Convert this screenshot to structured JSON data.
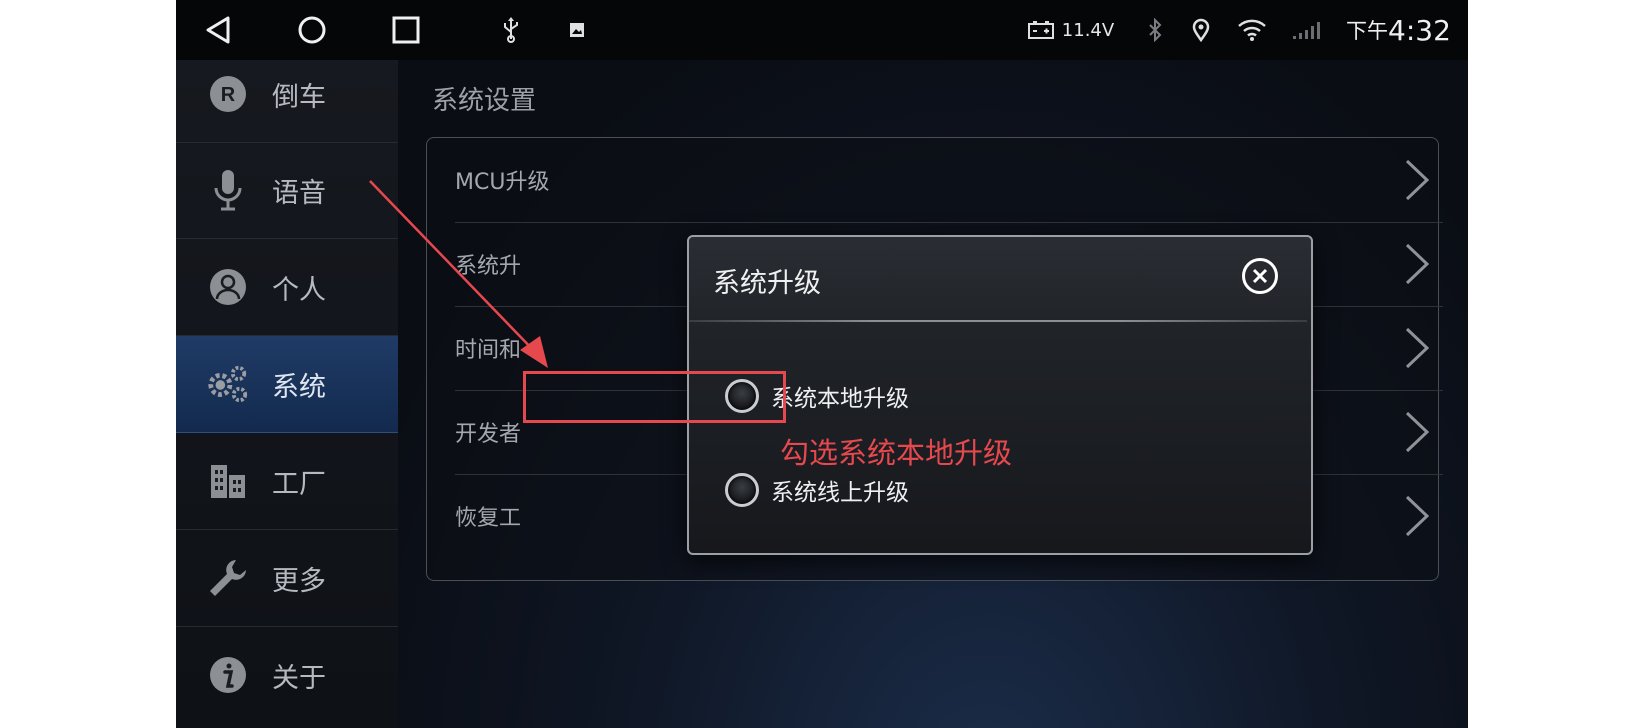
{
  "statusbar": {
    "voltage": "11.4V",
    "time_prefix": "下午",
    "time": "4:32",
    "nav_icons": [
      "back-icon",
      "home-icon",
      "recents-icon"
    ],
    "status_icons": [
      "usb-icon",
      "image-icon",
      "battery-icon",
      "bluetooth-icon",
      "location-icon",
      "wifi-icon",
      "signal-icon"
    ]
  },
  "sidebar": {
    "items": [
      {
        "label": "倒车",
        "icon": "reverse-r-icon"
      },
      {
        "label": "语音",
        "icon": "microphone-icon"
      },
      {
        "label": "个人",
        "icon": "person-icon"
      },
      {
        "label": "系统",
        "icon": "gears-icon",
        "active": true
      },
      {
        "label": "工厂",
        "icon": "factory-icon"
      },
      {
        "label": "更多",
        "icon": "wrench-icon"
      },
      {
        "label": "关于",
        "icon": "info-icon"
      }
    ]
  },
  "main": {
    "title": "系统设置",
    "rows": [
      {
        "label": "MCU升级"
      },
      {
        "label": "系统升"
      },
      {
        "label": "时间和"
      },
      {
        "label": "开发者"
      },
      {
        "label": "恢复工"
      }
    ]
  },
  "dialog": {
    "title": "系统升级",
    "options": [
      {
        "label": "系统本地升级"
      },
      {
        "label": "系统线上升级"
      }
    ]
  },
  "annotation": {
    "text": "勾选系统本地升级",
    "color": "#e5484d"
  },
  "colors": {
    "accent_active": "#1f3b66",
    "voice_button": "#f0d21a"
  }
}
